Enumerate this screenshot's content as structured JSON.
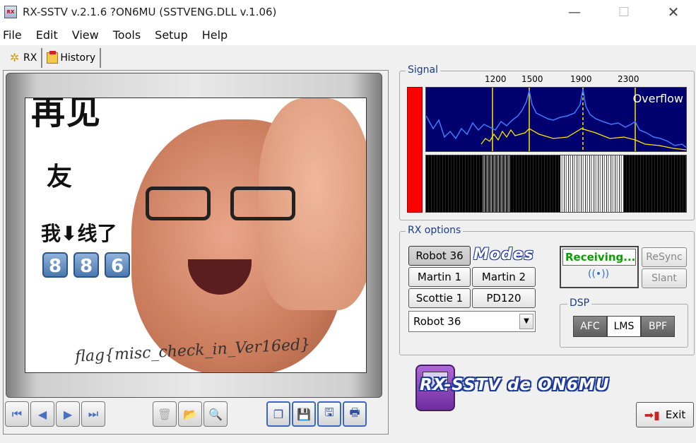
{
  "window": {
    "title": "RX-SSTV v.2.1.6 ?ON6MU (SSTVENG.DLL v.1.06)",
    "icon_text": "RX"
  },
  "menu": [
    "File",
    "Edit",
    "View",
    "Tools",
    "Setup",
    "Help"
  ],
  "tabs": [
    {
      "label": "RX",
      "icon": "gear-icon"
    },
    {
      "label": "History",
      "icon": "history-icon"
    }
  ],
  "image": {
    "top_text": "再见",
    "text_line1": "友",
    "text_line2": "我⬇线了",
    "numbers": [
      "8",
      "8",
      "6"
    ],
    "flag_text": "flag{misc_check_in_Ver16ed}"
  },
  "signal": {
    "title": "Signal",
    "freq_labels": [
      "1200",
      "1500",
      "1900",
      "2300"
    ],
    "status": "Overflow",
    "level_color": "#ff0000"
  },
  "rx_options": {
    "title": "RX options",
    "modes_logo": "Modes",
    "mode_buttons": [
      "Robot 36",
      "Martin 1",
      "Martin 2",
      "Scottie 1",
      "PD120"
    ],
    "selected_mode": "Robot 36",
    "receiving": "Receiving...",
    "resync": "ReSync",
    "slant": "Slant",
    "dsp": {
      "title": "DSP",
      "buttons": [
        "AFC",
        "LMS",
        "BPF"
      ]
    }
  },
  "logo_text": "RX-SSTV de ON6MU",
  "exit_label": "Exit",
  "toolbar_icons": {
    "nav": [
      "first-icon",
      "prev-icon",
      "next-icon",
      "last-icon"
    ],
    "tools": [
      "trash-icon",
      "folder-icon",
      "zoom-icon"
    ],
    "file": [
      "copy-icon",
      "save-icon",
      "save-as-icon",
      "print-icon"
    ]
  }
}
